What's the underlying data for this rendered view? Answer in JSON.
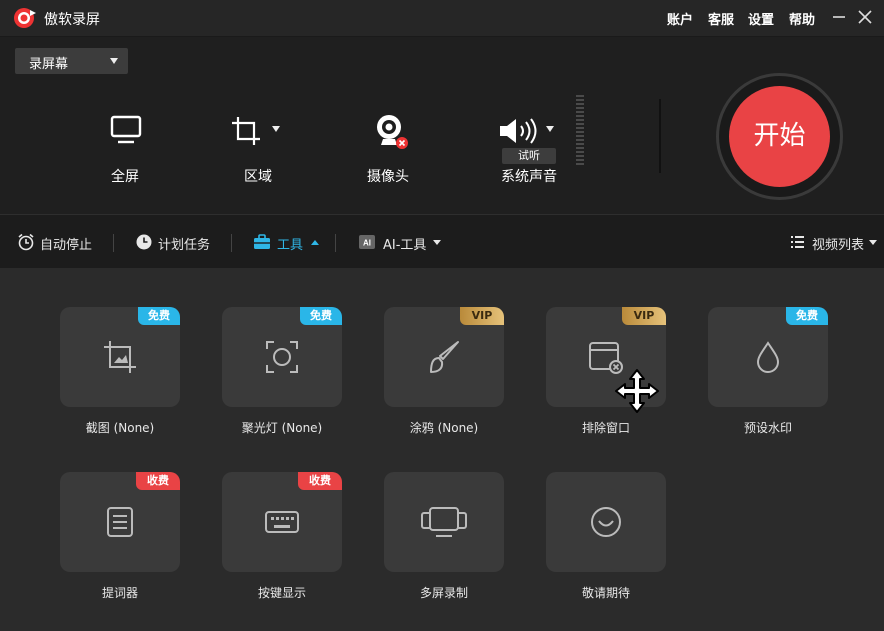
{
  "app": {
    "title": "傲软录屏",
    "logo_icon": "record-logo-icon",
    "menu": [
      "账户",
      "客服",
      "设置",
      "帮助"
    ],
    "window_buttons": [
      "minimize-icon",
      "close-icon"
    ]
  },
  "record_mode": {
    "selected": "录屏幕"
  },
  "sources": [
    {
      "id": "fullscreen",
      "label": "全屏",
      "icon": "monitor-icon"
    },
    {
      "id": "region",
      "label": "区域",
      "icon": "crop-icon"
    },
    {
      "id": "camera",
      "label": "摄像头",
      "icon": "webcam-icon",
      "status": "disabled"
    },
    {
      "id": "audio",
      "label": "系统声音",
      "icon": "speaker-icon",
      "test_label": "试听"
    }
  ],
  "start_button": {
    "label": "开始",
    "color": "#e94345"
  },
  "toolbar": {
    "auto_stop": "自动停止",
    "schedule": "计划任务",
    "tools": "工具",
    "ai_tools": "AI-工具",
    "video_list": "视频列表",
    "active_color": "#2fb6e6"
  },
  "tools": [
    {
      "label": "截图 (None)",
      "badge": "免费",
      "badge_type": "free",
      "icon": "screenshot-crop-icon"
    },
    {
      "label": "聚光灯 (None)",
      "badge": "免费",
      "badge_type": "free",
      "icon": "spotlight-icon"
    },
    {
      "label": "涂鸦 (None)",
      "badge": "VIP",
      "badge_type": "vip",
      "icon": "brush-icon"
    },
    {
      "label": "排除窗口",
      "badge": "VIP",
      "badge_type": "vip",
      "icon": "exclude-window-icon"
    },
    {
      "label": "预设水印",
      "badge": "免费",
      "badge_type": "free",
      "icon": "watermark-drop-icon"
    },
    {
      "label": "提词器",
      "badge": "收费",
      "badge_type": "paid",
      "icon": "teleprompter-icon"
    },
    {
      "label": "按键显示",
      "badge": "收费",
      "badge_type": "paid",
      "icon": "keyboard-icon"
    },
    {
      "label": "多屏录制",
      "badge": "",
      "badge_type": "none",
      "icon": "multi-screen-icon"
    },
    {
      "label": "敬请期待",
      "badge": "",
      "badge_type": "none",
      "icon": "coming-soon-icon"
    }
  ]
}
